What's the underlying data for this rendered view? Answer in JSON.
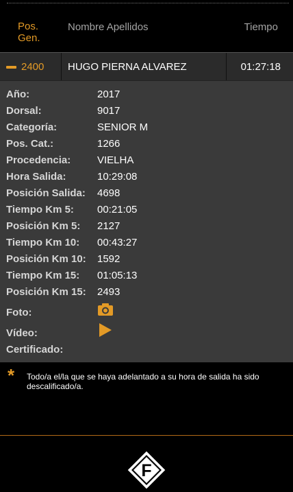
{
  "header": {
    "pos_label": "Pos. Gen.",
    "name_label": "Nombre Apellidos",
    "time_label": "Tiempo"
  },
  "result": {
    "position": "2400",
    "name": "HUGO PIERNA ALVAREZ",
    "time": "01:27:18"
  },
  "details": [
    {
      "label": "Año:",
      "value": "2017"
    },
    {
      "label": "Dorsal:",
      "value": "9017"
    },
    {
      "label": "Categoría:",
      "value": "SENIOR M"
    },
    {
      "label": "Pos. Cat.:",
      "value": "1266"
    },
    {
      "label": "Procedencia:",
      "value": "VIELHA"
    },
    {
      "label": "Hora Salida:",
      "value": "10:29:08"
    },
    {
      "label": "Posición Salida:",
      "value": "4698"
    },
    {
      "label": "Tiempo Km 5:",
      "value": "00:21:05"
    },
    {
      "label": "Posición Km 5:",
      "value": "2127"
    },
    {
      "label": "Tiempo Km 10:",
      "value": "00:43:27"
    },
    {
      "label": "Posición Km 10:",
      "value": "1592"
    },
    {
      "label": "Tiempo Km 15:",
      "value": "01:05:13"
    },
    {
      "label": "Posición Km 15:",
      "value": "2493"
    }
  ],
  "media": {
    "photo_label": "Foto:",
    "photo_icon": "camera-icon",
    "video_label": "Vídeo:",
    "video_icon": "play-icon",
    "certificate_label": "Certificado:"
  },
  "note": {
    "symbol": "*",
    "text": "Todo/a el/la que se haya adelantado a su hora de salida ha sido descalificado/a."
  },
  "footer": {
    "logo_letter": "F"
  },
  "colors": {
    "accent": "#e39a26",
    "panel": "#3a3a3a",
    "row": "#2b2b2b",
    "background": "#000000"
  }
}
